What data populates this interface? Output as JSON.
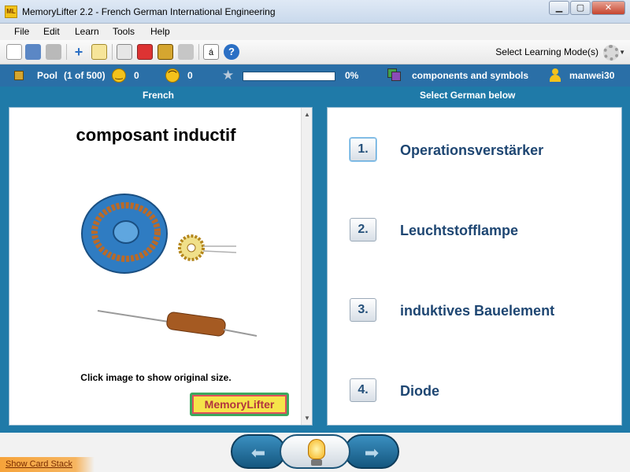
{
  "window": {
    "title": "MemoryLifter 2.2 - French German International Engineering",
    "app_icon_text": "ML",
    "minimize": "▁",
    "maximize": "▢",
    "close": "✕"
  },
  "menu": [
    "File",
    "Edit",
    "Learn",
    "Tools",
    "Help"
  ],
  "toolbar": {
    "mode_label": "Select Learning Mode(s)"
  },
  "status": {
    "pool_label": "Pool",
    "pool_count": "(1 of 500)",
    "happy_count": "0",
    "sad_count": "0",
    "progress_percent": "0%",
    "progress_value": 0,
    "chapter": "components and symbols",
    "user": "manwei30"
  },
  "columns": {
    "left_header": "French",
    "right_header": "Select German below"
  },
  "question": {
    "word": "composant inductif",
    "image_hint": "Click image to show original size.",
    "logo_text": "MemoryLifter"
  },
  "answers": [
    {
      "num": "1.",
      "label": "Operationsverstärker"
    },
    {
      "num": "2.",
      "label": "Leuchtstofflampe"
    },
    {
      "num": "3.",
      "label": "induktives Bauelement"
    },
    {
      "num": "4.",
      "label": "Diode"
    }
  ],
  "bottom": {
    "show_stack": "Show Card Stack",
    "prev_arrow": "⬅",
    "next_arrow": "➡"
  },
  "colors": {
    "accent_blue": "#1f7aa8",
    "answer_text": "#1e4672",
    "status_bar": "#2a6fa7"
  }
}
